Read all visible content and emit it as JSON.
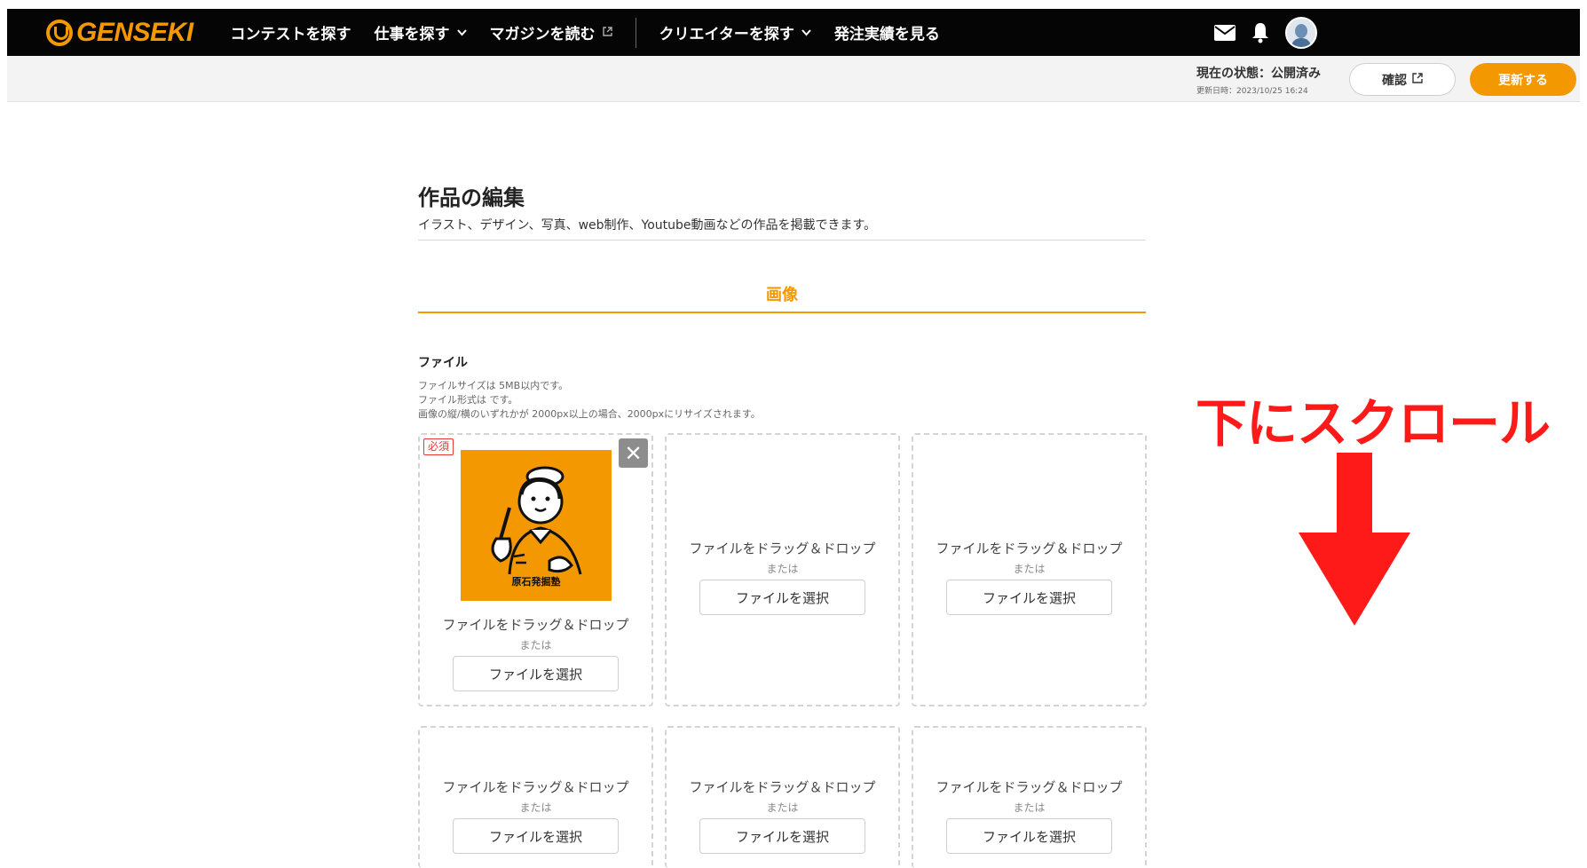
{
  "header": {
    "logo_text": "GENSEKI",
    "nav": [
      {
        "label": "コンテストを探す"
      },
      {
        "label": "仕事を探す"
      },
      {
        "label": "マガジンを読む"
      },
      {
        "label": "クリエイターを探す"
      },
      {
        "label": "発注実績を見る"
      }
    ]
  },
  "statusbar": {
    "status": "現在の状態：公開済み",
    "updated": "更新日時：2023/10/25 16:24",
    "confirm_label": "確認",
    "update_label": "更新する"
  },
  "page": {
    "title": "作品の編集",
    "description": "イラスト、デザイン、写真、web制作、Youtube動画などの作品を掲載できます。",
    "section_tab": "画像",
    "file_label": "ファイル",
    "notes": [
      "ファイルサイズは 5MB以内です。",
      "ファイル形式は です。",
      "画像の縦/横のいずれかが 2000px以上の場合、2000pxにリサイズされます。"
    ]
  },
  "upload": {
    "required_badge": "必須",
    "remove_symbol": "✕",
    "thumbnail_caption": "原石発掘塾",
    "dnd_text": "ファイルをドラッグ＆ドロップ",
    "or_text": "または",
    "select_label": "ファイルを選択"
  },
  "annotation": {
    "text": "下にスクロール"
  },
  "colors": {
    "accent": "#f39800",
    "nav_bg": "#050505",
    "annotation": "#ff1a1a"
  },
  "icons": [
    "mail-icon",
    "bell-icon",
    "avatar",
    "chevron-down-icon",
    "external-link-icon",
    "close-icon",
    "down-arrow"
  ]
}
